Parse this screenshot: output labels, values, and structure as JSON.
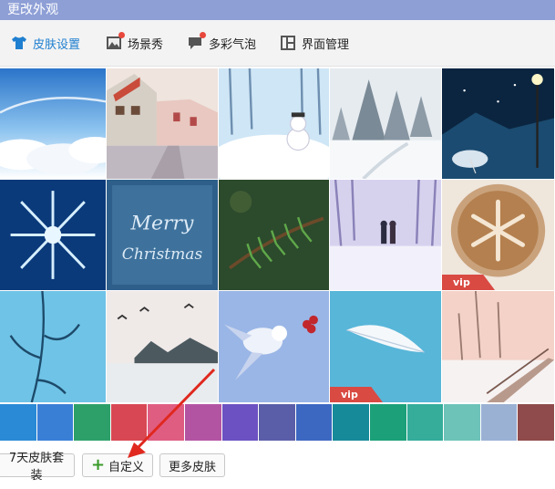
{
  "window": {
    "title": "更改外观"
  },
  "tabs": [
    {
      "label": "皮肤设置",
      "icon": "tshirt-icon",
      "active": true,
      "badge": false
    },
    {
      "label": "场景秀",
      "icon": "picture-icon",
      "active": false,
      "badge": true
    },
    {
      "label": "多彩气泡",
      "icon": "bubble-icon",
      "active": false,
      "badge": true
    },
    {
      "label": "界面管理",
      "icon": "layout-icon",
      "active": false,
      "badge": false
    }
  ],
  "skins": [
    {
      "theme": "sky-clouds"
    },
    {
      "theme": "snowy-street"
    },
    {
      "theme": "snowman-forest"
    },
    {
      "theme": "snowy-pines"
    },
    {
      "theme": "night-lamp"
    },
    {
      "theme": "snowflake-crystal"
    },
    {
      "theme": "merry-christmas-glass"
    },
    {
      "theme": "pine-branch"
    },
    {
      "theme": "couple-snow-path"
    },
    {
      "theme": "snowflake-latte",
      "vip": "vip"
    },
    {
      "theme": "frozen-branches"
    },
    {
      "theme": "winter-lake-birds"
    },
    {
      "theme": "bird-berries"
    },
    {
      "theme": "feather-blue",
      "vip": "vip"
    },
    {
      "theme": "snowy-bridge"
    }
  ],
  "swatches": [
    "#2a8ad6",
    "#3a7fd6",
    "#2da06a",
    "#d84854",
    "#e05d82",
    "#b354a3",
    "#6b51c1",
    "#5a5ea8",
    "#3d68c2",
    "#178a9a",
    "#1ca07a",
    "#35ad9a",
    "#6ec3b8",
    "#9ab1d4",
    "#8f4b4b"
  ],
  "buttons": {
    "suite": "7天皮肤套装",
    "custom": "自定义",
    "more": "更多皮肤"
  }
}
